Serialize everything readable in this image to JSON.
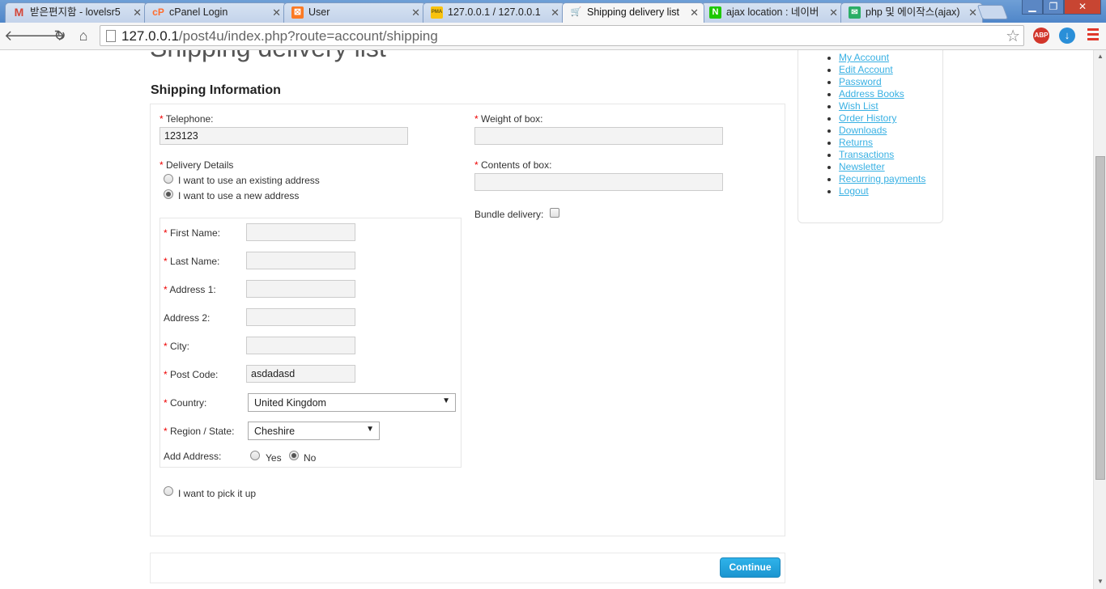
{
  "browser": {
    "tabs": [
      {
        "title": "받은편지함 - lovelsr5",
        "icon": "gmail-icon",
        "favicon_text": "M",
        "favicon_color": "#d44638",
        "active": false
      },
      {
        "title": "cPanel Login",
        "icon": "cpanel-icon",
        "favicon_text": "cP",
        "favicon_color": "#ff6c2c",
        "active": false
      },
      {
        "title": "User",
        "icon": "xampp-icon",
        "favicon_text": "⊠",
        "favicon_color": "#fb7a24",
        "active": false
      },
      {
        "title": "127.0.0.1 / 127.0.0.1",
        "icon": "phpmyadmin-icon",
        "favicon_text": "PMA",
        "favicon_color": "#f89c0e",
        "active": false
      },
      {
        "title": "Shipping delivery list",
        "icon": "cart-icon",
        "favicon_text": "🛒",
        "favicon_color": "#6b7a8f",
        "active": true
      },
      {
        "title": "ajax location : 네이버",
        "icon": "naver-icon",
        "favicon_text": "N",
        "favicon_color": "#1ec800",
        "active": false
      },
      {
        "title": "php 및 에이작스(ajax)",
        "icon": "blog-icon",
        "favicon_text": "✉",
        "favicon_color": "#2bae66",
        "active": false
      }
    ],
    "url_host": "127.0.0.1",
    "url_path": "/post4u/index.php?route=account/shipping",
    "ext_abp": "ABP"
  },
  "page": {
    "title": "Shipping delivery list",
    "section_title": "Shipping Information"
  },
  "form": {
    "telephone_label": "Telephone:",
    "telephone_value": "123123",
    "weight_label": "Weight of box:",
    "weight_value": "",
    "contents_label": "Contents of box:",
    "contents_value": "",
    "bundle_label": "Bundle delivery:",
    "bundle_checked": false,
    "delivery_label": "Delivery Details",
    "opt_existing": "I want to use an existing address",
    "opt_new": "I want to use a new address",
    "opt_pickup": "I want to pick it up",
    "delivery_selected": "new",
    "address": {
      "first_name_label": "First Name:",
      "first_name_value": "",
      "last_name_label": "Last Name:",
      "last_name_value": "",
      "address1_label": "Address 1:",
      "address1_value": "",
      "address2_label": "Address 2:",
      "address2_value": "",
      "city_label": "City:",
      "city_value": "",
      "postcode_label": "Post Code:",
      "postcode_value": "asdadasd",
      "country_label": "Country:",
      "country_value": "United Kingdom",
      "region_label": "Region / State:",
      "region_value": "Cheshire",
      "add_address_label": "Add Address:",
      "yes_label": "Yes",
      "no_label": "No",
      "add_address_selected": "no"
    },
    "required_mark": "*",
    "continue_label": "Continue"
  },
  "sidebar": {
    "links": [
      "My Account",
      "Edit Account",
      "Password",
      "Address Books",
      "Wish List",
      "Order History",
      "Downloads",
      "Returns",
      "Transactions",
      "Newsletter",
      "Recurring payments",
      "Logout"
    ]
  },
  "colors": {
    "link": "#38b0e3",
    "required": "#e00000",
    "button": "#1b95d0"
  }
}
